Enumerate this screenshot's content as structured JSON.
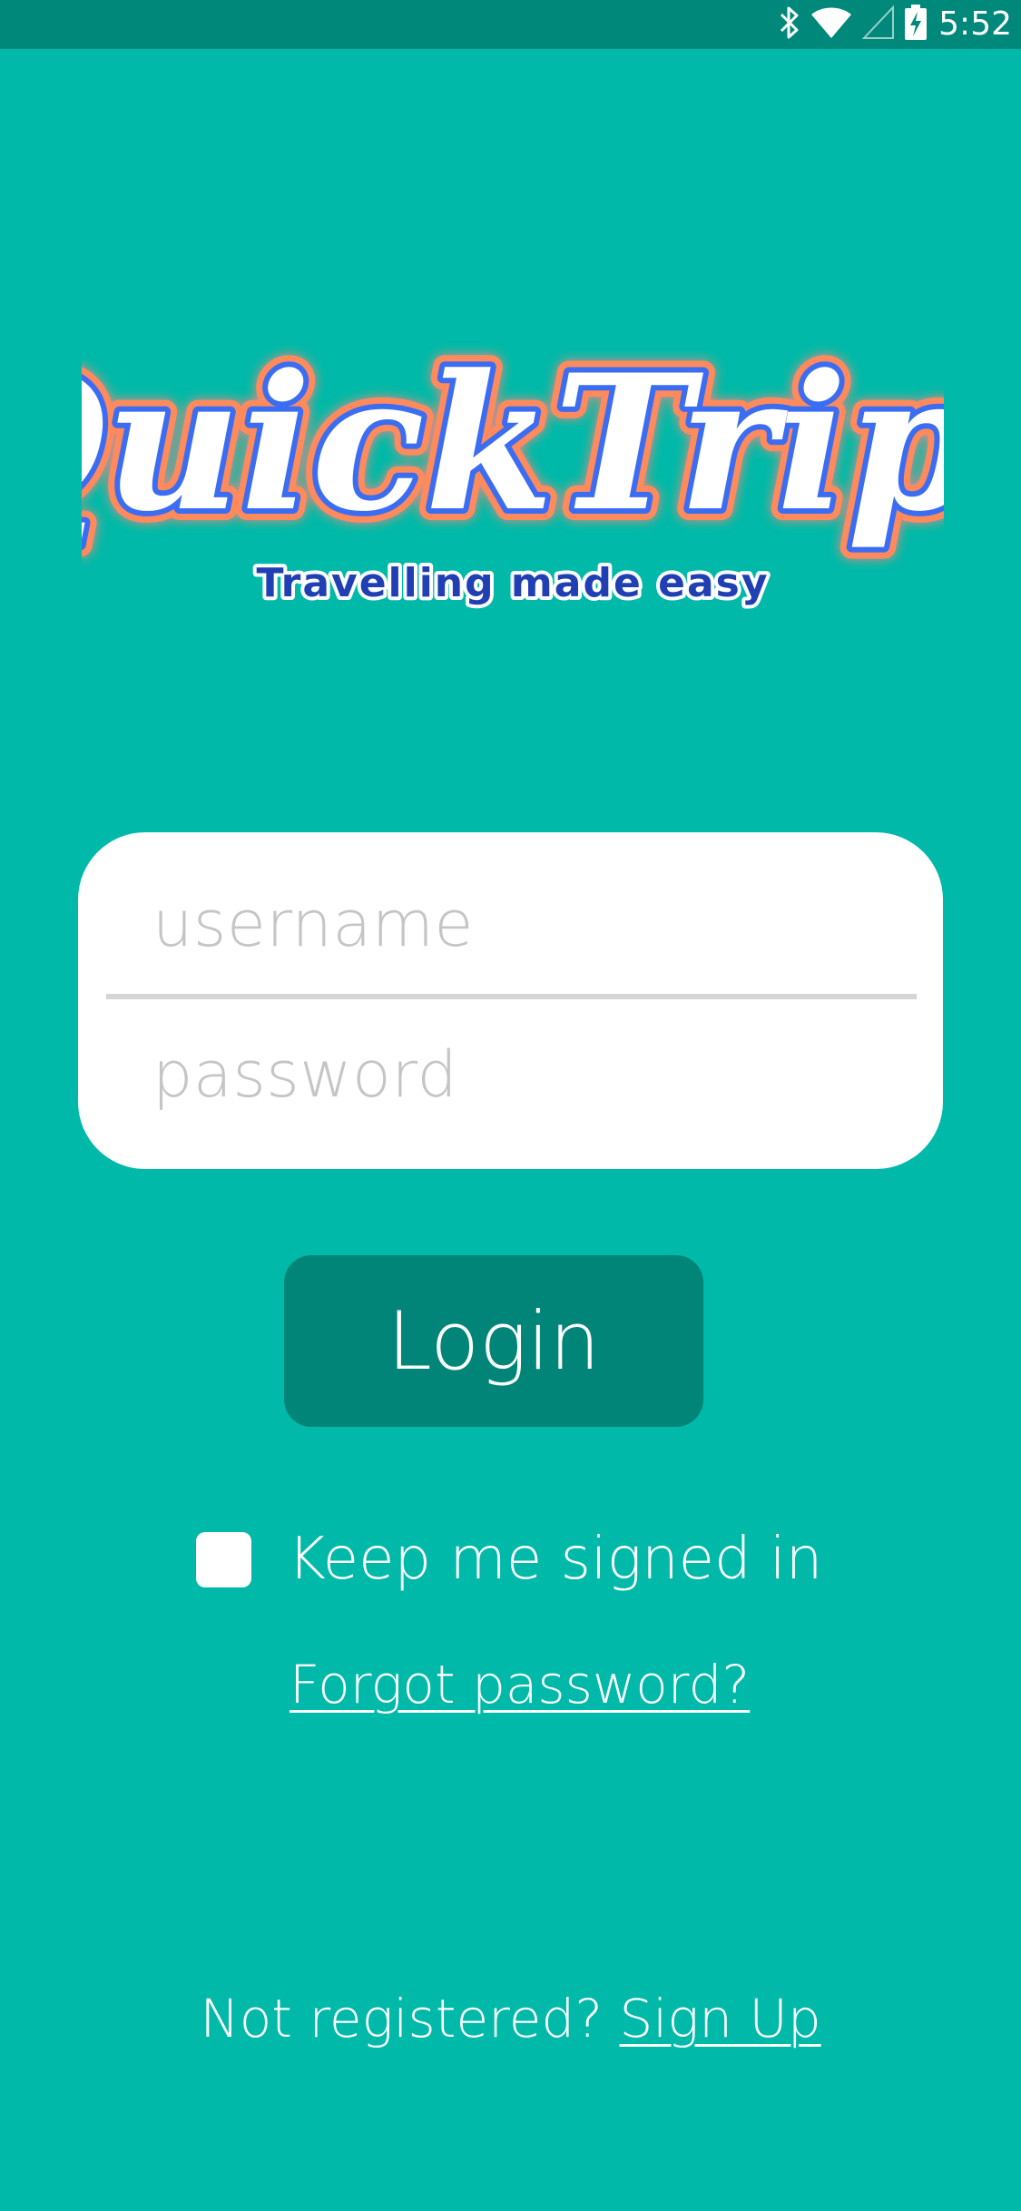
{
  "status_bar": {
    "time": "5:52",
    "icons": [
      "bluetooth-icon",
      "wifi-icon",
      "cellular-signal-icon",
      "battery-charging-icon"
    ],
    "background_color": "#00887a"
  },
  "branding": {
    "logo_text": "QuickTrips",
    "tagline": "Travelling made easy",
    "logo_fill_color": "#ffffff",
    "logo_inner_stroke_color": "#3b6df2",
    "logo_outer_stroke_color": "#ff8a5b",
    "tagline_color": "#1f3fb3"
  },
  "login_form": {
    "username": {
      "value": "",
      "placeholder": "username"
    },
    "password": {
      "value": "",
      "placeholder": "password"
    },
    "login_button_label": "Login",
    "keep_signed_in": {
      "label": "Keep me signed in",
      "checked": false
    },
    "forgot_password_label": "Forgot password?"
  },
  "footer": {
    "prompt_text": "Not registered? ",
    "signup_label": "Sign Up"
  },
  "colors": {
    "background": "#00b9a9",
    "button": "#008578",
    "card": "#ffffff",
    "placeholder": "#c5c5c5"
  }
}
